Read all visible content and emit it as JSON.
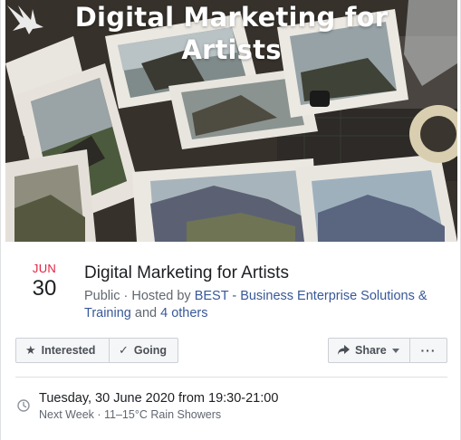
{
  "cover": {
    "title_line1": "Digital Marketing for",
    "title_line2": "Artists"
  },
  "event": {
    "month": "JUN",
    "day": "30",
    "title": "Digital Marketing for Artists",
    "meta_prefix": "Public · Hosted by ",
    "host_link": "BEST - Business Enterprise Solutions & Training",
    "meta_and": " and ",
    "others_link": "4 others"
  },
  "actions": {
    "interested_label": "Interested",
    "going_label": "Going",
    "share_label": "Share",
    "more_label": "···"
  },
  "details": {
    "datetime": "Tuesday, 30 June 2020 from 19:30-21:00",
    "sub": "Next Week · 11–15°C Rain Showers"
  },
  "colors": {
    "month_red": "#e41e3f",
    "link_blue": "#385898",
    "secondary_text": "#606770"
  }
}
